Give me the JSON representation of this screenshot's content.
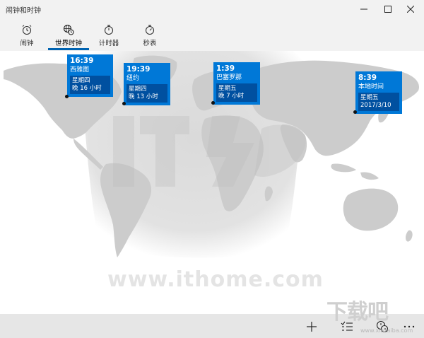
{
  "window": {
    "title": "闹钟和时钟"
  },
  "tabs": [
    {
      "label": "闹钟",
      "icon": "alarm-clock-icon",
      "active": false
    },
    {
      "label": "世界时钟",
      "icon": "world-clock-icon",
      "active": true
    },
    {
      "label": "计时器",
      "icon": "timer-icon",
      "active": false
    },
    {
      "label": "秒表",
      "icon": "stopwatch-icon",
      "active": false
    }
  ],
  "clocks": [
    {
      "time": "16:39",
      "city": "西雅图",
      "day": "星期四",
      "offset": "晚 16 小时"
    },
    {
      "time": "19:39",
      "city": "纽约",
      "day": "星期四",
      "offset": "晚 13 小时"
    },
    {
      "time": "1:39",
      "city": "巴塞罗那",
      "day": "星期五",
      "offset": "晚 7 小时"
    },
    {
      "time": "8:39",
      "city": "本地时间",
      "day": "星期五",
      "offset": "2017/3/10"
    }
  ],
  "watermark": {
    "url": "www.ithome.com",
    "corner": "下载吧",
    "corner_sub": "www.xiazaiba.com"
  },
  "commands": [
    {
      "icon": "add-icon"
    },
    {
      "icon": "select-list-icon"
    },
    {
      "icon": "compare-clocks-icon"
    },
    {
      "icon": "more-icon"
    }
  ],
  "colors": {
    "accent": "#0078d7",
    "accent_dark": "#0050a0",
    "map_land": "#cccccc",
    "night": "#dcdcdc"
  }
}
